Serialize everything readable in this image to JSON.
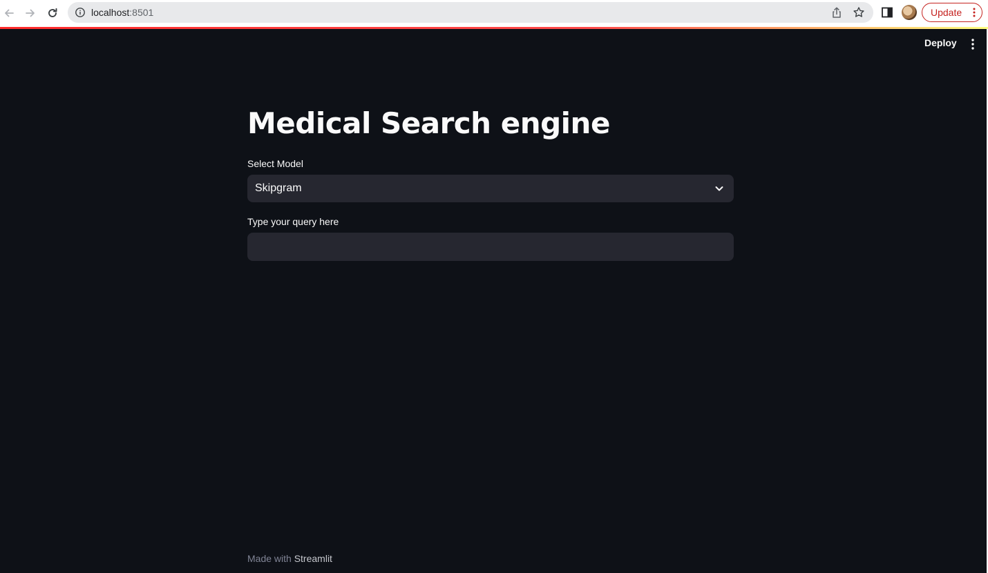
{
  "browser": {
    "url_host": "localhost",
    "url_port": ":8501",
    "update_label": "Update"
  },
  "colors": {
    "app_background": "#0e1117",
    "widget_background": "#262730",
    "text": "#fafafa",
    "update_red": "#c5221f",
    "accent": "#ff4b4b"
  },
  "icons": {
    "back": "arrow-left-icon",
    "forward": "arrow-right-icon",
    "reload": "reload-icon",
    "info": "info-icon",
    "share": "share-icon",
    "bookmark": "star-icon",
    "side_panel": "side-panel-icon",
    "profile": "avatar",
    "app_menu": "kebab-menu-icon",
    "select": "chevron-down-icon"
  },
  "toolbar": {
    "deploy_label": "Deploy"
  },
  "main": {
    "title": "Medical Search engine",
    "model_select": {
      "label": "Select Model",
      "value": "Skipgram"
    },
    "query_input": {
      "label": "Type your query here",
      "value": "",
      "placeholder": ""
    }
  },
  "footer": {
    "prefix": "Made with",
    "brand": "Streamlit"
  }
}
